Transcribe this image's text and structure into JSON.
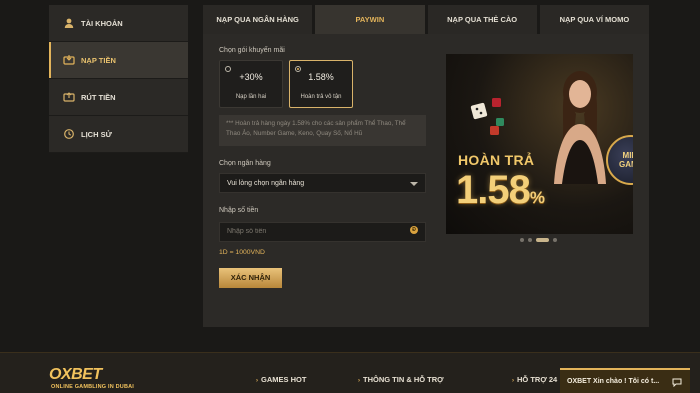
{
  "sidebar": {
    "items": [
      {
        "label": "TÀI KHOẢN",
        "icon": "user-icon"
      },
      {
        "label": "NẠP TIỀN",
        "icon": "deposit-icon"
      },
      {
        "label": "RÚT TIỀN",
        "icon": "withdraw-icon"
      },
      {
        "label": "LỊCH SỬ",
        "icon": "history-icon"
      }
    ],
    "active_index": 1
  },
  "tabs": [
    {
      "label": "NẠP QUA NGÂN HÀNG"
    },
    {
      "label": "PAYWIN"
    },
    {
      "label": "NẠP QUA THẺ CÀO"
    },
    {
      "label": "NẠP QUA VÍ MOMO"
    }
  ],
  "active_tab": 1,
  "form": {
    "promo_label": "Chọn gói khuyến mãi",
    "promos": [
      {
        "value": "+30%",
        "name": "Nạp lần hai"
      },
      {
        "value": "1.58%",
        "name": "Hoàn trả vô tận"
      }
    ],
    "selected_promo": 1,
    "note": "*** Hoàn trả hàng ngày 1.58% cho các sản phẩm Thể Thao, Thể Thao Ảo, Number Game, Keno, Quay Số, Nổ Hũ",
    "bank_label": "Chọn ngân hàng",
    "bank_select_value": "Vui lòng chọn ngân hàng",
    "amount_label": "Nhập số tiền",
    "amount_placeholder": "Nhập số tiền",
    "amount_value": "",
    "coin_symbol": "Đ",
    "rate_text": "1D = 1000VND",
    "submit_label": "XÁC NHẬN"
  },
  "banner": {
    "title": "HOÀN TRẢ",
    "percent": "1.58",
    "percent_sign": "%",
    "badge_line1": "MINI",
    "badge_line2": "GAME",
    "slide_count": 4,
    "active_slide": 2
  },
  "footer": {
    "logo_main": "OXBET",
    "logo_sub": "ONLINE GAMBLING IN DUBAI",
    "links": [
      "GAMES HOT",
      "THÔNG TIN & HỖ TRỢ",
      "HỖ TRỢ 24"
    ]
  },
  "chat": {
    "text": "OXBET Xin chào ! Tôi có t..."
  },
  "colors": {
    "accent": "#e3b45b",
    "background": "#1a1917",
    "panel": "#2c2a27"
  }
}
